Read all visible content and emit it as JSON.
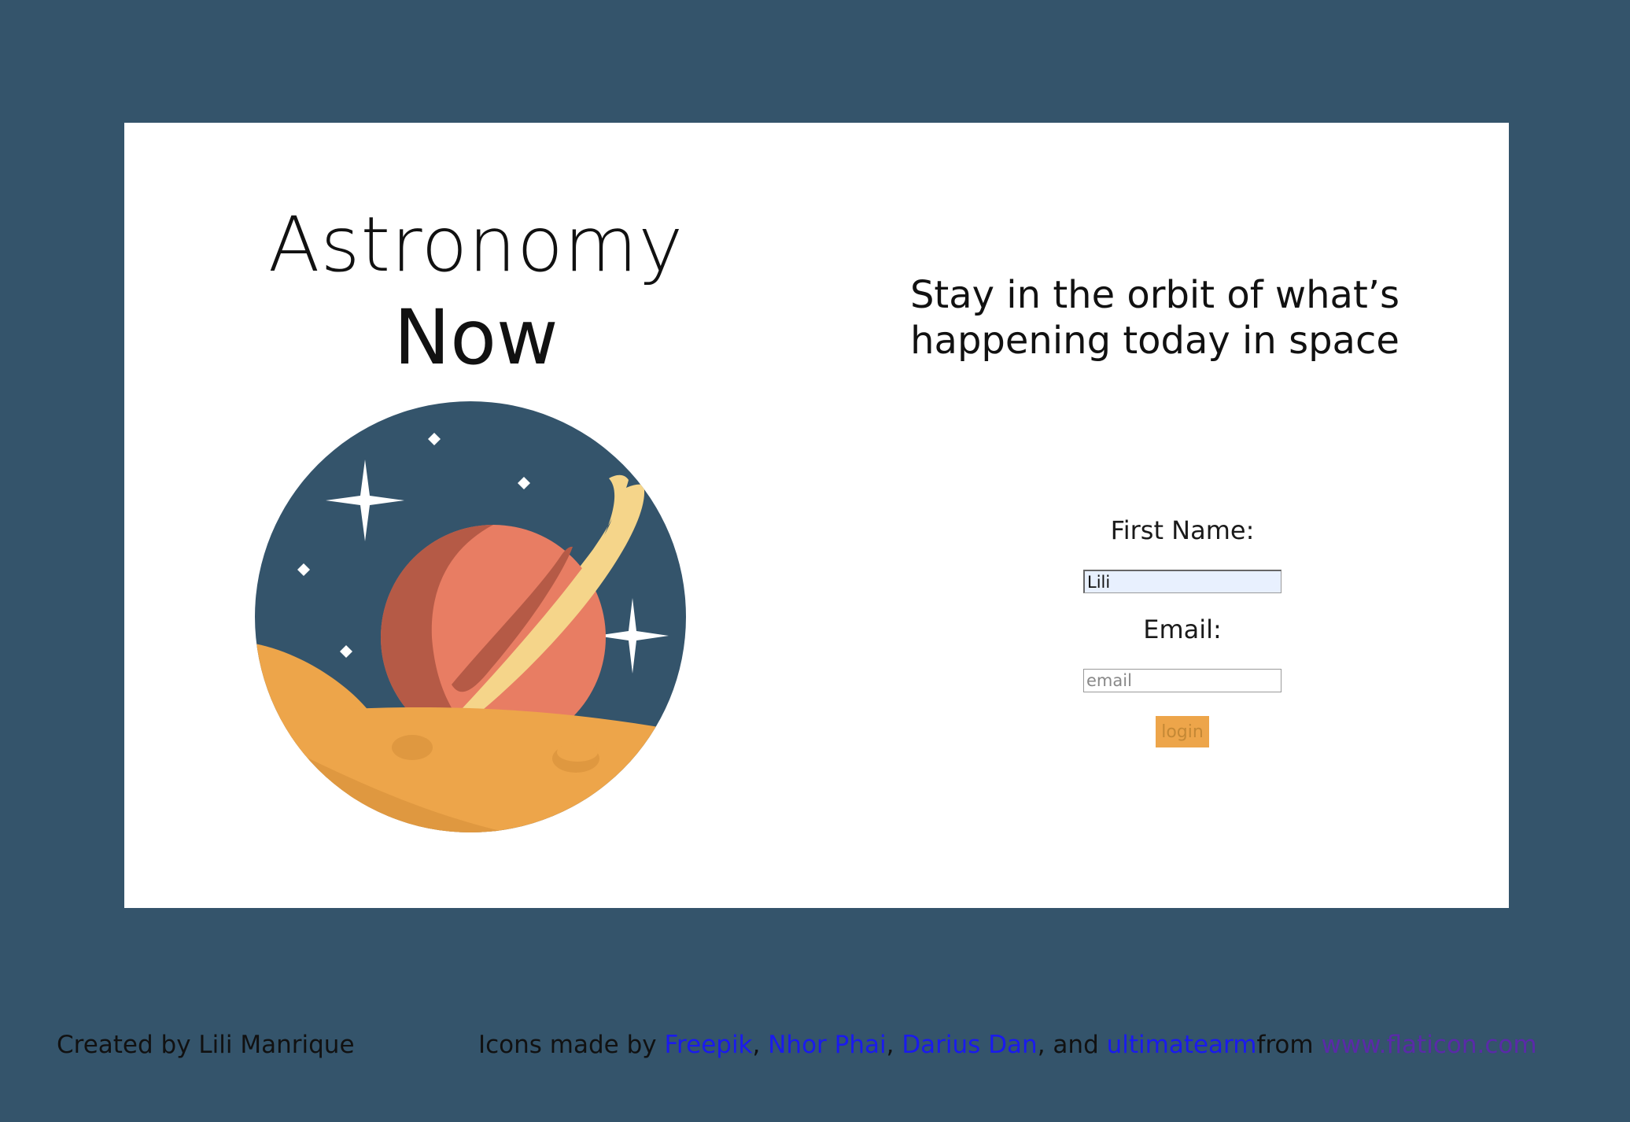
{
  "brand": {
    "line1": "Astronomy",
    "line2": "Now"
  },
  "tagline": {
    "line1": "Stay in the orbit of what’s",
    "line2": "happening today in space"
  },
  "form": {
    "first_name_label": "First Name:",
    "first_name_value": "Lili",
    "email_label": "Email:",
    "email_placeholder": "email",
    "login_label": "login"
  },
  "footer": {
    "credit": "Created by Lili Manrique",
    "icons_prefix": "Icons made by ",
    "author1": "Freepik",
    "sep1": ", ",
    "author2": "Nhor Phai",
    "sep2": ", ",
    "author3": "Darius Dan",
    "sep3": ", and ",
    "author4": "ultimatearm",
    "from_text": "from ",
    "site": "www.flaticon.com"
  },
  "hero": {
    "icon": "planet-illustration-icon"
  },
  "colors": {
    "page_background": "#34546b",
    "card_background": "#ffffff",
    "login_button": "#eda54a",
    "link_blue": "#1a1aee",
    "link_visited": "#5a2aa8"
  }
}
